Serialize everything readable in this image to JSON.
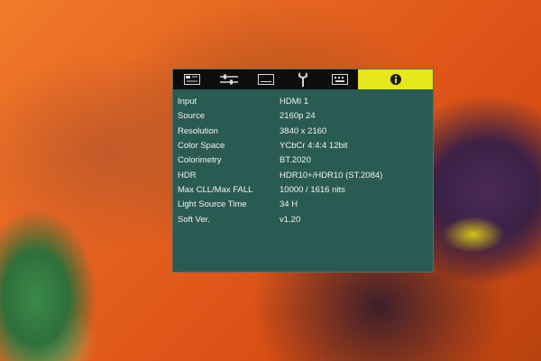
{
  "tabs": [
    {
      "icon": "picture-icon",
      "active": false
    },
    {
      "icon": "settings-sliders-icon",
      "active": false
    },
    {
      "icon": "screen-icon",
      "active": false
    },
    {
      "icon": "wrench-icon",
      "active": false
    },
    {
      "icon": "keyboard-icon",
      "active": false
    },
    {
      "icon": "info-icon",
      "active": true
    }
  ],
  "info_rows": [
    {
      "label": "Input",
      "value": "HDMI 1"
    },
    {
      "label": "Source",
      "value": "2160p 24"
    },
    {
      "label": "Resolution",
      "value": "3840 x 2160"
    },
    {
      "label": "Color Space",
      "value": "YCbCr 4:4:4 12bit"
    },
    {
      "label": "Colorimetry",
      "value": "BT.2020"
    },
    {
      "label": "HDR",
      "value": "HDR10+/HDR10 (ST.2084)"
    },
    {
      "label": "Max CLL/Max FALL",
      "value": "10000 / 1616 nits"
    },
    {
      "label": "Light Source Time",
      "value": "34 H"
    },
    {
      "label": "Soft Ver.",
      "value": "v1.20"
    }
  ],
  "colors": {
    "panel": "#2a5b52",
    "tabbar": "#0d0d0d",
    "active_tab": "#e6e61a",
    "text": "#f2f2f2"
  }
}
